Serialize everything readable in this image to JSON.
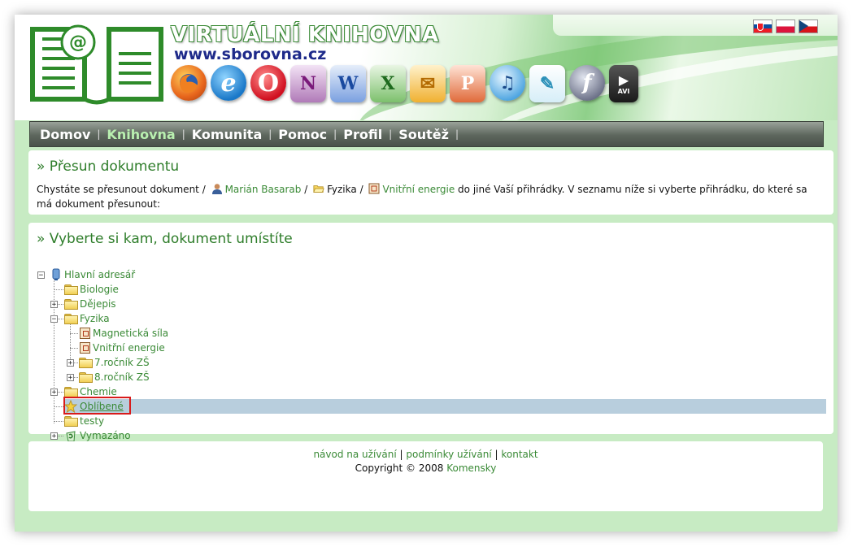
{
  "header": {
    "title": "VIRTUÁLNÍ KNIHOVNA",
    "url": "www.sborovna.cz",
    "flags": [
      "slovak-flag",
      "polish-flag",
      "czech-flag"
    ],
    "apps": [
      {
        "name": "firefox-icon",
        "color": "#e0661c"
      },
      {
        "name": "internet-explorer-icon",
        "color": "#1a78c8",
        "glyph": "e"
      },
      {
        "name": "opera-icon",
        "color": "#d01020",
        "glyph": "O"
      },
      {
        "name": "onenote-icon",
        "color": "#8a2a8a",
        "glyph": "N"
      },
      {
        "name": "word-icon",
        "color": "#2a5db0",
        "glyph": "W"
      },
      {
        "name": "excel-icon",
        "color": "#2f8a2f",
        "glyph": "X"
      },
      {
        "name": "outlook-icon",
        "color": "#e8a020",
        "glyph": "O"
      },
      {
        "name": "powerpoint-icon",
        "color": "#d84a1a",
        "glyph": "P"
      },
      {
        "name": "itunes-icon",
        "color": "#4aa3e0",
        "glyph": "♫"
      },
      {
        "name": "feather-icon",
        "color": "#3aa0c8",
        "glyph": "✎"
      },
      {
        "name": "flash-icon",
        "color": "#6a6a7a",
        "glyph": "f"
      },
      {
        "name": "avi-video-icon",
        "color": "#2a2a2a",
        "glyph": "▶"
      }
    ]
  },
  "nav": {
    "items": [
      {
        "label": "Domov",
        "active": false
      },
      {
        "label": "Knihovna",
        "active": true
      },
      {
        "label": "Komunita",
        "active": false
      },
      {
        "label": "Pomoc",
        "active": false
      },
      {
        "label": "Profil",
        "active": false
      },
      {
        "label": "Soutěž",
        "active": false
      }
    ],
    "separator": "|"
  },
  "move_panel": {
    "title": "» Přesun dokumentu",
    "text_before": "Chystáte se přesunout dokument /",
    "user": "Marián Basarab",
    "sep1": "/",
    "folder": "Fyzika",
    "sep2": "/",
    "document": "Vnitřní energie",
    "text_after": "do jiné Vaší přihrádky. V seznamu níže si vyberte přihrádku, do které sa má dokument přesunout:"
  },
  "tree_panel": {
    "title": "» Vyberte si kam, dokument umístíte",
    "nodes": {
      "root": "Hlavní adresář",
      "biologie": "Biologie",
      "dejepis": "Dějepis",
      "fyzika": "Fyzika",
      "magneticka": "Magnetická síla",
      "vnitrni": "Vnitřní energie",
      "r7": "7.ročník ZŠ",
      "r8": "8.ročník ZŠ",
      "chemie": "Chemie",
      "oblibene": "Oblíbené",
      "testy": "testy",
      "vymazano": "Vymazáno"
    },
    "expander_plus": "+",
    "expander_minus": "−"
  },
  "footer": {
    "link1": "návod na užívání",
    "sep": "|",
    "link2": "podmínky užívání",
    "link3": "kontakt",
    "copyright": "Copyright © 2008",
    "company": "Komensky"
  }
}
